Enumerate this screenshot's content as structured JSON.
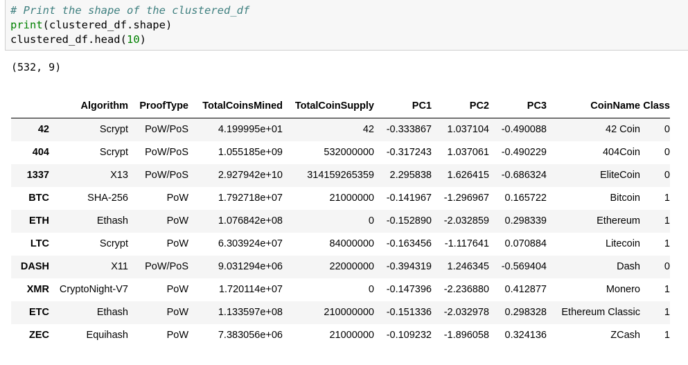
{
  "code": {
    "line1": "# Print the shape of the clustered_df",
    "line2_fn": "print",
    "line2_rest": "(clustered_df.shape)",
    "line3_pre": "clustered_df.head(",
    "line3_num": "10",
    "line3_post": ")"
  },
  "output": {
    "shape_text": "(532, 9)"
  },
  "table": {
    "index_header": "",
    "columns": [
      "Algorithm",
      "ProofType",
      "TotalCoinsMined",
      "TotalCoinSupply",
      "PC1",
      "PC2",
      "PC3",
      "CoinName",
      "Class"
    ],
    "rows": [
      {
        "index": "42",
        "cells": [
          "Scrypt",
          "PoW/PoS",
          "4.199995e+01",
          "42",
          "-0.333867",
          "1.037104",
          "-0.490088",
          "42 Coin",
          "0"
        ]
      },
      {
        "index": "404",
        "cells": [
          "Scrypt",
          "PoW/PoS",
          "1.055185e+09",
          "532000000",
          "-0.317243",
          "1.037061",
          "-0.490229",
          "404Coin",
          "0"
        ]
      },
      {
        "index": "1337",
        "cells": [
          "X13",
          "PoW/PoS",
          "2.927942e+10",
          "314159265359",
          "2.295838",
          "1.626415",
          "-0.686324",
          "EliteCoin",
          "0"
        ]
      },
      {
        "index": "BTC",
        "cells": [
          "SHA-256",
          "PoW",
          "1.792718e+07",
          "21000000",
          "-0.141967",
          "-1.296967",
          "0.165722",
          "Bitcoin",
          "1"
        ]
      },
      {
        "index": "ETH",
        "cells": [
          "Ethash",
          "PoW",
          "1.076842e+08",
          "0",
          "-0.152890",
          "-2.032859",
          "0.298339",
          "Ethereum",
          "1"
        ]
      },
      {
        "index": "LTC",
        "cells": [
          "Scrypt",
          "PoW",
          "6.303924e+07",
          "84000000",
          "-0.163456",
          "-1.117641",
          "0.070884",
          "Litecoin",
          "1"
        ]
      },
      {
        "index": "DASH",
        "cells": [
          "X11",
          "PoW/PoS",
          "9.031294e+06",
          "22000000",
          "-0.394319",
          "1.246345",
          "-0.569404",
          "Dash",
          "0"
        ]
      },
      {
        "index": "XMR",
        "cells": [
          "CryptoNight-V7",
          "PoW",
          "1.720114e+07",
          "0",
          "-0.147396",
          "-2.236880",
          "0.412877",
          "Monero",
          "1"
        ]
      },
      {
        "index": "ETC",
        "cells": [
          "Ethash",
          "PoW",
          "1.133597e+08",
          "210000000",
          "-0.151336",
          "-2.032978",
          "0.298328",
          "Ethereum Classic",
          "1"
        ]
      },
      {
        "index": "ZEC",
        "cells": [
          "Equihash",
          "PoW",
          "7.383056e+06",
          "21000000",
          "-0.109232",
          "-1.896058",
          "0.324136",
          "ZCash",
          "1"
        ]
      }
    ]
  }
}
